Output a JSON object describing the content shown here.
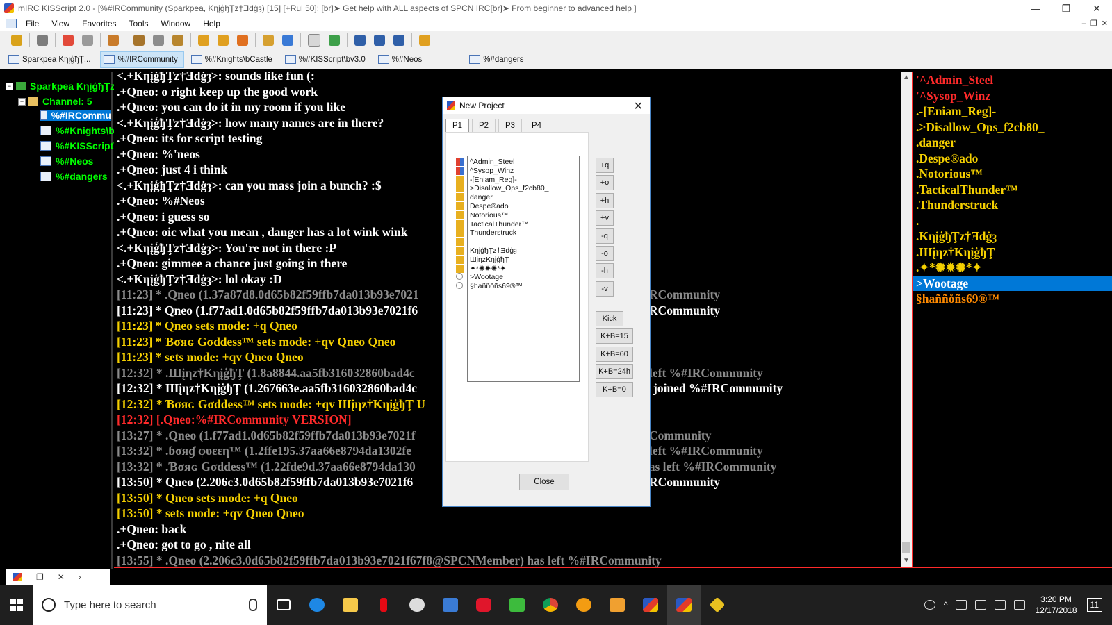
{
  "window": {
    "title": "mIRC KISScript 2.0 - [%#IRCommunity (Sparkpea, Kηįģђ̃Ţᴢ†Ǝdġȝ) [15] [+Rul 50]: [br]➤ Get help with ALL aspects of SPCN IRC[br]➤ From beginner to advanced help ]",
    "min": "—",
    "restore": "❐",
    "close": "✕"
  },
  "menu": {
    "items": [
      "File",
      "View",
      "Favorites",
      "Tools",
      "Window",
      "Help"
    ],
    "mdi_min": "–",
    "mdi_restore": "❐",
    "mdi_close": "✕"
  },
  "switchbar": {
    "tabs": [
      "Sparkpea KηįģђŢ...",
      "%#IRCommunity",
      "%#Knights\\bCastle",
      "%#KISScript\\bv3.0",
      "%#Neos",
      "%#dangers"
    ]
  },
  "tree": {
    "server": "Sparkpea KηįģђŢᴢ",
    "channel_group": "Channel: 5",
    "channels": [
      "%#IRCommu",
      "%#Knights\\bC",
      "%#KISScript\\",
      "%#Neos",
      "%#dangers"
    ]
  },
  "chat": {
    "lines": [
      {
        "text": "<.+KηįģђŢᴢ†Ǝdġȝ>: sounds like fun (:",
        "color": "white"
      },
      {
        "text": ".+Qneo: o right keep up the good work",
        "color": "white"
      },
      {
        "text": ".+Qneo: you can do it in my room if you like",
        "color": "white"
      },
      {
        "text": "<.+KηįģђŢᴢ†Ǝdġȝ>: how many names are in there?",
        "color": "white"
      },
      {
        "text": ".+Qneo: its for script testing",
        "color": "white"
      },
      {
        "text": ".+Qneo: %'neos",
        "color": "white"
      },
      {
        "text": ".+Qneo: just 4 i think",
        "color": "white"
      },
      {
        "text": "<.+KηįģђŢᴢ†Ǝdġȝ>: can you mass join a bunch? :$",
        "color": "white"
      },
      {
        "text": ".+Qneo: %#Neos",
        "color": "white"
      },
      {
        "text": ".+Qneo: i guess so",
        "color": "white"
      },
      {
        "text": ".+Qneo: oic what you mean , danger has a lot wink wink",
        "color": "white"
      },
      {
        "text": "<.+KηįģђŢᴢ†Ǝdġȝ>: You're not in there :P",
        "color": "white"
      },
      {
        "text": ".+Qneo: gimmee a chance just going in there",
        "color": "white"
      },
      {
        "text": "<.+KηįģђŢᴢ†Ǝdġȝ>: lol okay :D",
        "color": "white"
      },
      {
        "text": "[11:23] * .Qneo (1.37a87d8.0d65b82f59ffb7da013b93e7021",
        "tail": "RCommunity",
        "color": "grey"
      },
      {
        "text": "[11:23] * Qneo (1.f77ad1.0d65b82f59ffb7da013b93e7021f6",
        "tail": "RCommunity",
        "color": "white"
      },
      {
        "text": "[11:23] * Qneo sets mode: +q Qneo",
        "color": "yellow"
      },
      {
        "text": "[11:23] * Ɓσяɢ Gσddess™ sets mode: +qv Qneo Qneo",
        "color": "yellow"
      },
      {
        "text": "[11:23] *                    sets mode: +qv Qneo Qneo",
        "color": "yellow"
      },
      {
        "text": "[12:32] * .Шįηᴢ†KηįģђŢ (1.8a8844.aa5fb316032860bad4c",
        "tail": "left %#IRCommunity",
        "color": "grey"
      },
      {
        "text": "[12:32] * Шįηᴢ†KηįģђŢ (1.267663e.aa5fb316032860bad4c",
        "tail": "joined %#IRCommunity",
        "color": "white"
      },
      {
        "text": "[12:32] * Ɓσяɢ Gσddess™ sets mode: +qv Шįηᴢ†KηįģђŢ U",
        "color": "yellow"
      },
      {
        "text": "[12:32] [.Qneo:%#IRCommunity VERSION]",
        "color": "red"
      },
      {
        "text": "[13:27] * .Qneo (1.f77ad1.0d65b82f59ffb7da013b93e7021f",
        "tail": "Community",
        "color": "grey"
      },
      {
        "text": "[13:32] * .ɓσяɠ φυεεη™  (1.2ffe195.37aa66e8794da1302fe",
        "tail": "left %#IRCommunity",
        "color": "grey"
      },
      {
        "text": "[13:32] * .Ɓσяɢ Gσddess™ (1.22fde9d.37aa66e8794da130",
        "tail": "has left %#IRCommunity",
        "color": "grey"
      },
      {
        "text": "[13:50] * Qneo (2.206c3.0d65b82f59ffb7da013b93e7021f6",
        "tail": "RCommunity",
        "color": "white"
      },
      {
        "text": "[13:50] * Qneo sets mode: +q Qneo",
        "color": "yellow"
      },
      {
        "text": "[13:50] *                   sets mode: +qv Qneo Qneo",
        "color": "yellow"
      },
      {
        "text": ".+Qneo: back",
        "color": "white"
      },
      {
        "text": ".+Qneo: got to go , nite all",
        "color": "white"
      },
      {
        "text": "[13:55] * .Qneo (2.206c3.0d65b82f59ffb7da013b93e7021f67f8@SPCNMember) has left %#IRCommunity",
        "color": "grey"
      }
    ]
  },
  "scroll": {
    "up": "▲",
    "down": "▼"
  },
  "nicklist": {
    "items": [
      {
        "text": "'^Admin_Steel",
        "color": "red"
      },
      {
        "text": "'^Sysop_Winz",
        "color": "red"
      },
      {
        "text": ".-[Eniam_Reg]-",
        "color": "yellow"
      },
      {
        "text": ".>Disallow_Ops_f2cb80_",
        "color": "yellow"
      },
      {
        "text": ".danger",
        "color": "yellow"
      },
      {
        "text": ".Despe®ado",
        "color": "yellow"
      },
      {
        "text": ".Notorious™",
        "color": "yellow"
      },
      {
        "text": ".TacticalThunder™",
        "color": "yellow"
      },
      {
        "text": ".Thunderstruck",
        "color": "yellow"
      },
      {
        "text": ".",
        "color": "yellow"
      },
      {
        "text": ".KηįģђŢᴢ†Ǝdġȝ",
        "color": "yellow"
      },
      {
        "text": ".Шįηᴢ†KηįģђŢ",
        "color": "yellow"
      },
      {
        "text": ".✦*✺✹✺*✦",
        "color": "yellow"
      },
      {
        "text": ">Wootage",
        "color": "white",
        "selected": true
      },
      {
        "text": "§hañño̊ñs69®™",
        "color": "orange"
      }
    ]
  },
  "dialog": {
    "title": "New Project",
    "close": "✕",
    "tabs": [
      "P1",
      "P2",
      "P3",
      "P4"
    ],
    "list": [
      "^Admin_Steel",
      "^Sysop_Winz",
      "-[Eniam_Reg]-",
      ">Disallow_Ops_f2cb80_",
      "danger",
      "Despe®ado",
      "Notorious™",
      "TacticalThunder™",
      "Thunderstruck",
      "",
      "KηįģђŢᴢ†Ǝdġȝ",
      "ШįηᴢKηįģђŢ",
      "✦*✺✹✺*✦",
      ">Wootage",
      "§hañño̊ñs69®™"
    ],
    "mode_buttons": [
      "+q",
      "+o",
      "+h",
      "+v",
      "-q",
      "-o",
      "-h",
      "-v"
    ],
    "kick_buttons": [
      "Kick",
      "K+B=15",
      "K+B=60",
      "K+B=24h",
      "K+B=0"
    ],
    "close_label": "Close"
  },
  "mini_task": {
    "restore": "❐",
    "close": "✕",
    "more": "›"
  },
  "taskbar": {
    "search_placeholder": "Type here to search",
    "time": "3:20 PM",
    "date": "12/17/2018",
    "notif": "11"
  },
  "colors": {
    "white": "#ffffff",
    "grey": "#8c8c8c",
    "yellow": "#f5d000",
    "red": "#ff2a2a",
    "orange": "#ff8a00",
    "select": "#0078d7",
    "tree_green": "#00ff00"
  }
}
